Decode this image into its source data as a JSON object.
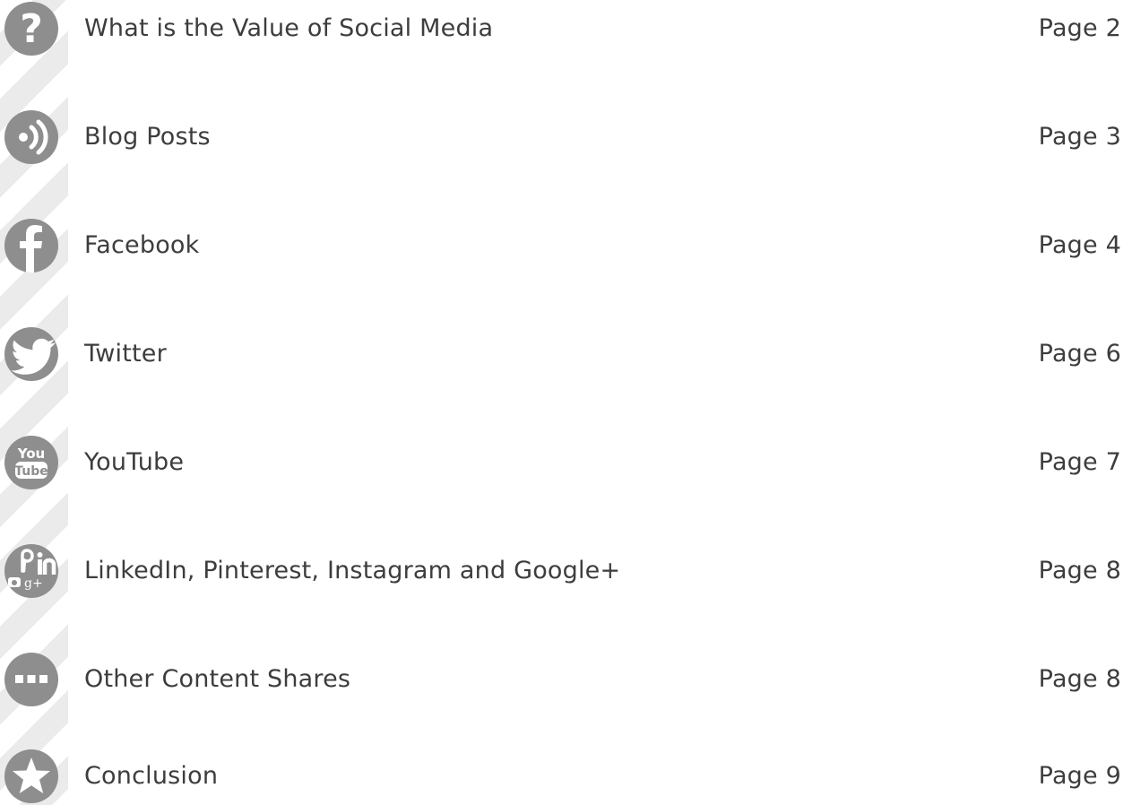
{
  "toc": {
    "items": [
      {
        "title": "What is the Value of Social Media",
        "page": "Page 2",
        "icon": "question-icon"
      },
      {
        "title": "Blog Posts",
        "page": "Page 3",
        "icon": "rss-icon"
      },
      {
        "title": "Facebook",
        "page": "Page 4",
        "icon": "facebook-icon"
      },
      {
        "title": "Twitter",
        "page": "Page 6",
        "icon": "twitter-icon"
      },
      {
        "title": "YouTube",
        "page": "Page 7",
        "icon": "youtube-icon",
        "icon_text_top": "You",
        "icon_text_bottom": "Tube"
      },
      {
        "title": "LinkedIn, Pinterest, Instagram and Google+",
        "page": "Page 8",
        "icon": "multi-social-icon"
      },
      {
        "title": "Other Content Shares",
        "page": "Page 8",
        "icon": "more-dots-icon"
      },
      {
        "title": "Conclusion",
        "page": "Page 9",
        "icon": "star-icon"
      }
    ]
  },
  "colors": {
    "icon_fill": "#8e8e8e",
    "text": "#3d3d3d",
    "stripe": "#ebebeb"
  }
}
